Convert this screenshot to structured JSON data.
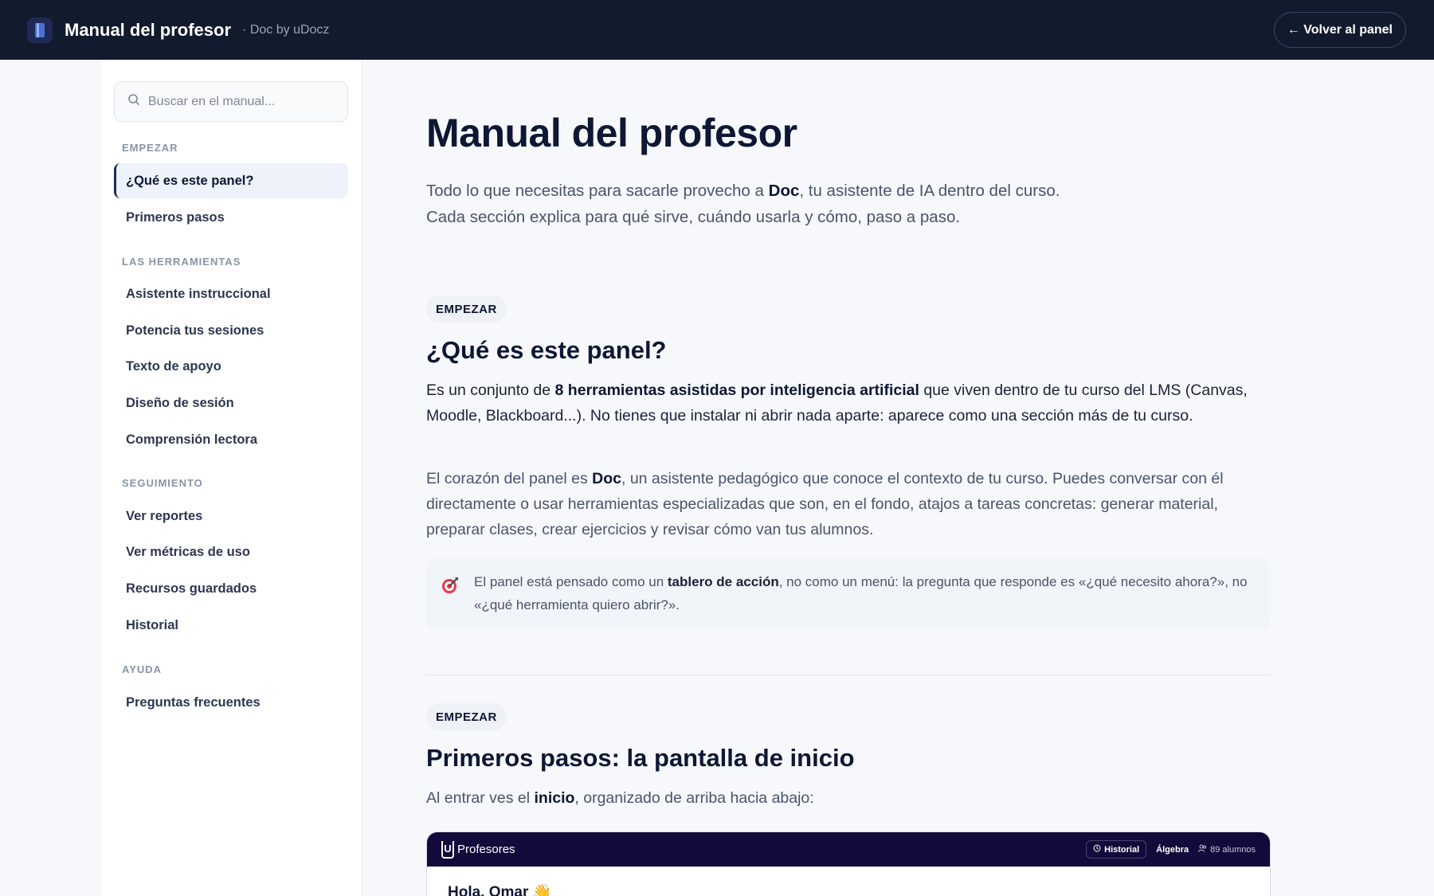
{
  "topbar": {
    "title": "Manual del profesor",
    "subtitle": "· Doc by uDocz",
    "back_label": "← Volver al panel"
  },
  "sidebar": {
    "search_placeholder": "Buscar en el manual...",
    "sections": [
      {
        "title": "EMPEZAR",
        "items": [
          "¿Qué es este panel?",
          "Primeros pasos"
        ]
      },
      {
        "title": "LAS HERRAMIENTAS",
        "items": [
          "Asistente instruccional",
          "Potencia tus sesiones",
          "Texto de apoyo",
          "Diseño de sesión",
          "Comprensión lectora"
        ]
      },
      {
        "title": "SEGUIMIENTO",
        "items": [
          "Ver reportes",
          "Ver métricas de uso",
          "Recursos guardados",
          "Historial"
        ]
      },
      {
        "title": "AYUDA",
        "items": [
          "Preguntas frecuentes"
        ]
      }
    ],
    "active_item": "¿Qué es este panel?"
  },
  "main": {
    "title": "Manual del profesor",
    "lead": {
      "a": "Todo lo que necesitas para sacarle provecho a ",
      "b": "Doc",
      "c": ", tu asistente de IA dentro del curso. Cada sección explica para qué sirve, cuándo usarla y cómo, paso a paso."
    },
    "section1": {
      "badge": "EMPEZAR",
      "title": "¿Qué es este panel?",
      "p1": {
        "a": "Es un conjunto de ",
        "b": "8 herramientas asistidas por inteligencia artificial",
        "c": " que viven dentro de tu curso del LMS (Canvas, Moodle, Blackboard...). No tienes que instalar ni abrir nada aparte: aparece como una sección más de tu curso."
      },
      "p2": {
        "a": "El corazón del panel es ",
        "b": "Doc",
        "c": ", un asistente pedagógico que conoce el contexto de tu curso. Puedes conversar con él directamente o usar herramientas especializadas que son, en el fondo, atajos a tareas concretas: generar material, preparar clases, crear ejercicios y revisar cómo van tus alumnos."
      },
      "callout": {
        "a": "El panel está pensado como un ",
        "b": "tablero de acción",
        "c": ", no como un menú: la pregunta que responde es «¿qué necesito ahora?», no «¿qué herramienta quiero abrir?»."
      }
    },
    "section2": {
      "badge": "EMPEZAR",
      "title": "Primeros pasos: la pantalla de inicio",
      "p1": {
        "a": "Al entrar ves el ",
        "b": "inicio",
        "c": ", organizado de arriba hacia abajo:"
      }
    },
    "preview": {
      "logo_letter": "U",
      "title": "Profesores",
      "history": "Historial",
      "course": "Álgebra",
      "students": "89 alumnos",
      "greeting": "Hola, Omar 👋"
    }
  }
}
